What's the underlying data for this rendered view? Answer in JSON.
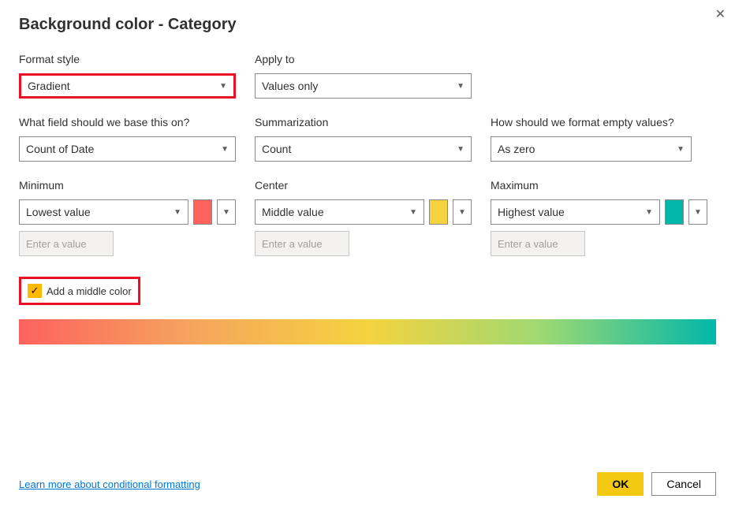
{
  "dialog": {
    "title": "Background color - Category",
    "close_icon": "✕"
  },
  "format_style": {
    "label": "Format style",
    "value": "Gradient"
  },
  "apply_to": {
    "label": "Apply to",
    "value": "Values only"
  },
  "base_field": {
    "label": "What field should we base this on?",
    "value": "Count of Date"
  },
  "summarization": {
    "label": "Summarization",
    "value": "Count"
  },
  "empty_values": {
    "label": "How should we format empty values?",
    "value": "As zero"
  },
  "minimum": {
    "label": "Minimum",
    "value": "Lowest value",
    "input_placeholder": "Enter a value",
    "color": "#fd625e"
  },
  "center": {
    "label": "Center",
    "value": "Middle value",
    "input_placeholder": "Enter a value",
    "color": "#f5d33f"
  },
  "maximum": {
    "label": "Maximum",
    "value": "Highest value",
    "input_placeholder": "Enter a value",
    "color": "#01b8aa"
  },
  "middle_color_checkbox": {
    "label": "Add a middle color",
    "checked": true
  },
  "footer": {
    "learn_more": "Learn more about conditional formatting",
    "ok": "OK",
    "cancel": "Cancel"
  }
}
